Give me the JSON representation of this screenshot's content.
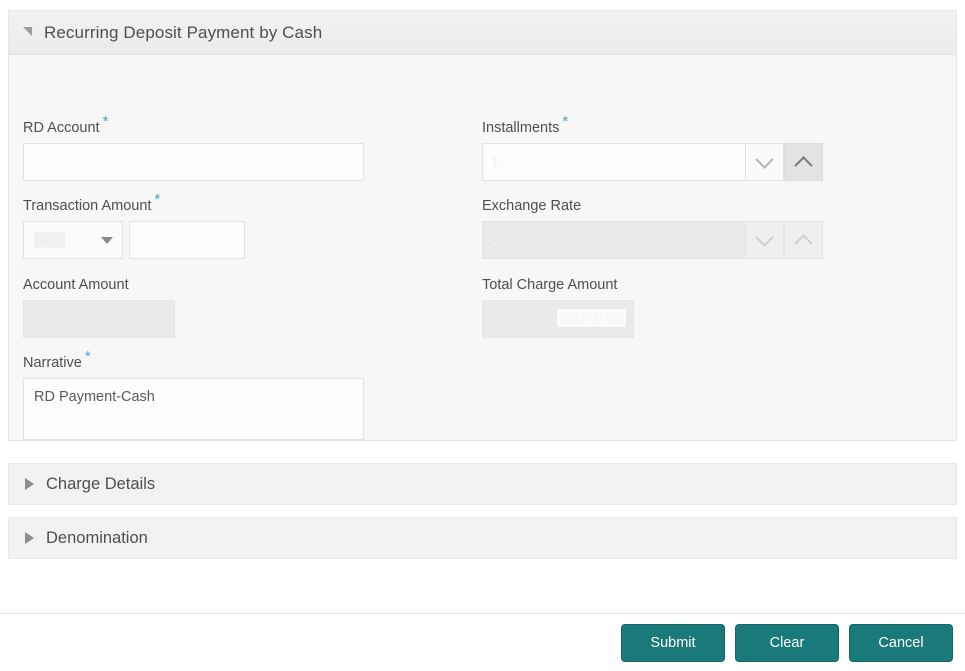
{
  "panel": {
    "title": "Recurring Deposit Payment by Cash",
    "expanded": true,
    "toggle_icon": "triangle-expanded-icon"
  },
  "form": {
    "rd_account": {
      "label": "RD Account",
      "required": true,
      "value": "",
      "placeholder": ""
    },
    "installments": {
      "label": "Installments",
      "required": true,
      "value": "1",
      "spinner_down_icon": "chevron-down-icon",
      "spinner_up_icon": "chevron-up-icon"
    },
    "transaction_amount": {
      "label": "Transaction Amount",
      "required": true,
      "currency": "GBP",
      "currency_caret_icon": "caret-down-icon",
      "amount": ""
    },
    "exchange_rate": {
      "label": "Exchange Rate",
      "required": false,
      "value": "1",
      "disabled": true,
      "spinner_down_icon": "chevron-down-icon",
      "spinner_up_icon": "chevron-up-icon"
    },
    "account_amount": {
      "label": "Account Amount",
      "required": false,
      "value": "",
      "disabled": true
    },
    "total_charge_amount": {
      "label": "Total Charge Amount",
      "required": false,
      "value": "GBP 0.00",
      "disabled": true
    },
    "narrative": {
      "label": "Narrative",
      "required": true,
      "value": "RD Payment-Cash"
    }
  },
  "sections": [
    {
      "title": "Charge Details",
      "expanded": false,
      "icon": "triangle-collapsed-icon"
    },
    {
      "title": "Denomination",
      "expanded": false,
      "icon": "triangle-collapsed-icon"
    }
  ],
  "footer": {
    "submit_label": "Submit",
    "clear_label": "Clear",
    "cancel_label": "Cancel"
  },
  "colors": {
    "button_accent": "#1a7a7a",
    "required_asterisk": "#4a9fd4",
    "panel_background": "#f7f7f7",
    "section_background": "#f2f2f2"
  }
}
